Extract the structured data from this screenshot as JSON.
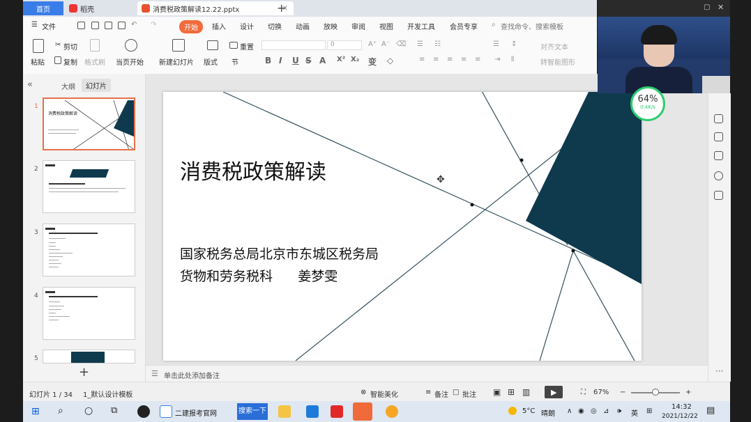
{
  "tabs": {
    "home": "首页",
    "daoke": "稻壳",
    "file": "消费税政策解读12.22.pptx"
  },
  "menu": {
    "file": "文件",
    "items": [
      "开始",
      "插入",
      "设计",
      "切换",
      "动画",
      "放映",
      "审阅",
      "视图",
      "开发工具",
      "会员专享"
    ],
    "search": "查找命令、搜索模板"
  },
  "ribbon": {
    "paste": "粘贴",
    "cut": "剪切",
    "copy": "复制",
    "format_painter": "格式刷",
    "from_current": "当页开始",
    "new_slide": "新建幻灯片",
    "layout": "版式",
    "section": "节",
    "reset": "重置",
    "font_size": "0",
    "align_text": "对齐文本",
    "convert_smartart": "转智能图形"
  },
  "outline_tab": "大纲",
  "slides_tab": "幻灯片",
  "thumbnails": [
    {
      "num": "1",
      "title": "消费税政策解读"
    },
    {
      "num": "2",
      "title": ""
    },
    {
      "num": "3",
      "title": ""
    },
    {
      "num": "4",
      "title": ""
    },
    {
      "num": "5",
      "title": ""
    }
  ],
  "slide": {
    "title": "消费税政策解读",
    "subtitle_line1": "国家税务总局北京市东城区税务局",
    "subtitle_line2": "货物和劳务税科      姜梦雯"
  },
  "notes_placeholder": "单击此处添加备注",
  "status": {
    "slide_counter": "幻灯片 1 / 34",
    "template": "1_默认设计模板",
    "smart_beautify": "智能美化",
    "notes": "备注",
    "comments": "批注",
    "zoom": "67%"
  },
  "taskbar": {
    "browser_tab": "二建报考官网",
    "search_btn": "搜索一下",
    "weather": "5°C",
    "weather_desc": "晴朗",
    "ime": "英",
    "time": "14:32",
    "date": "2021/12/22"
  },
  "speed": {
    "percent": "64%",
    "rate": "0.4K/s"
  },
  "colors": {
    "accent": "#f26b3a",
    "slide_shape": "#0f3a4d",
    "home_tab": "#3b7de8"
  }
}
